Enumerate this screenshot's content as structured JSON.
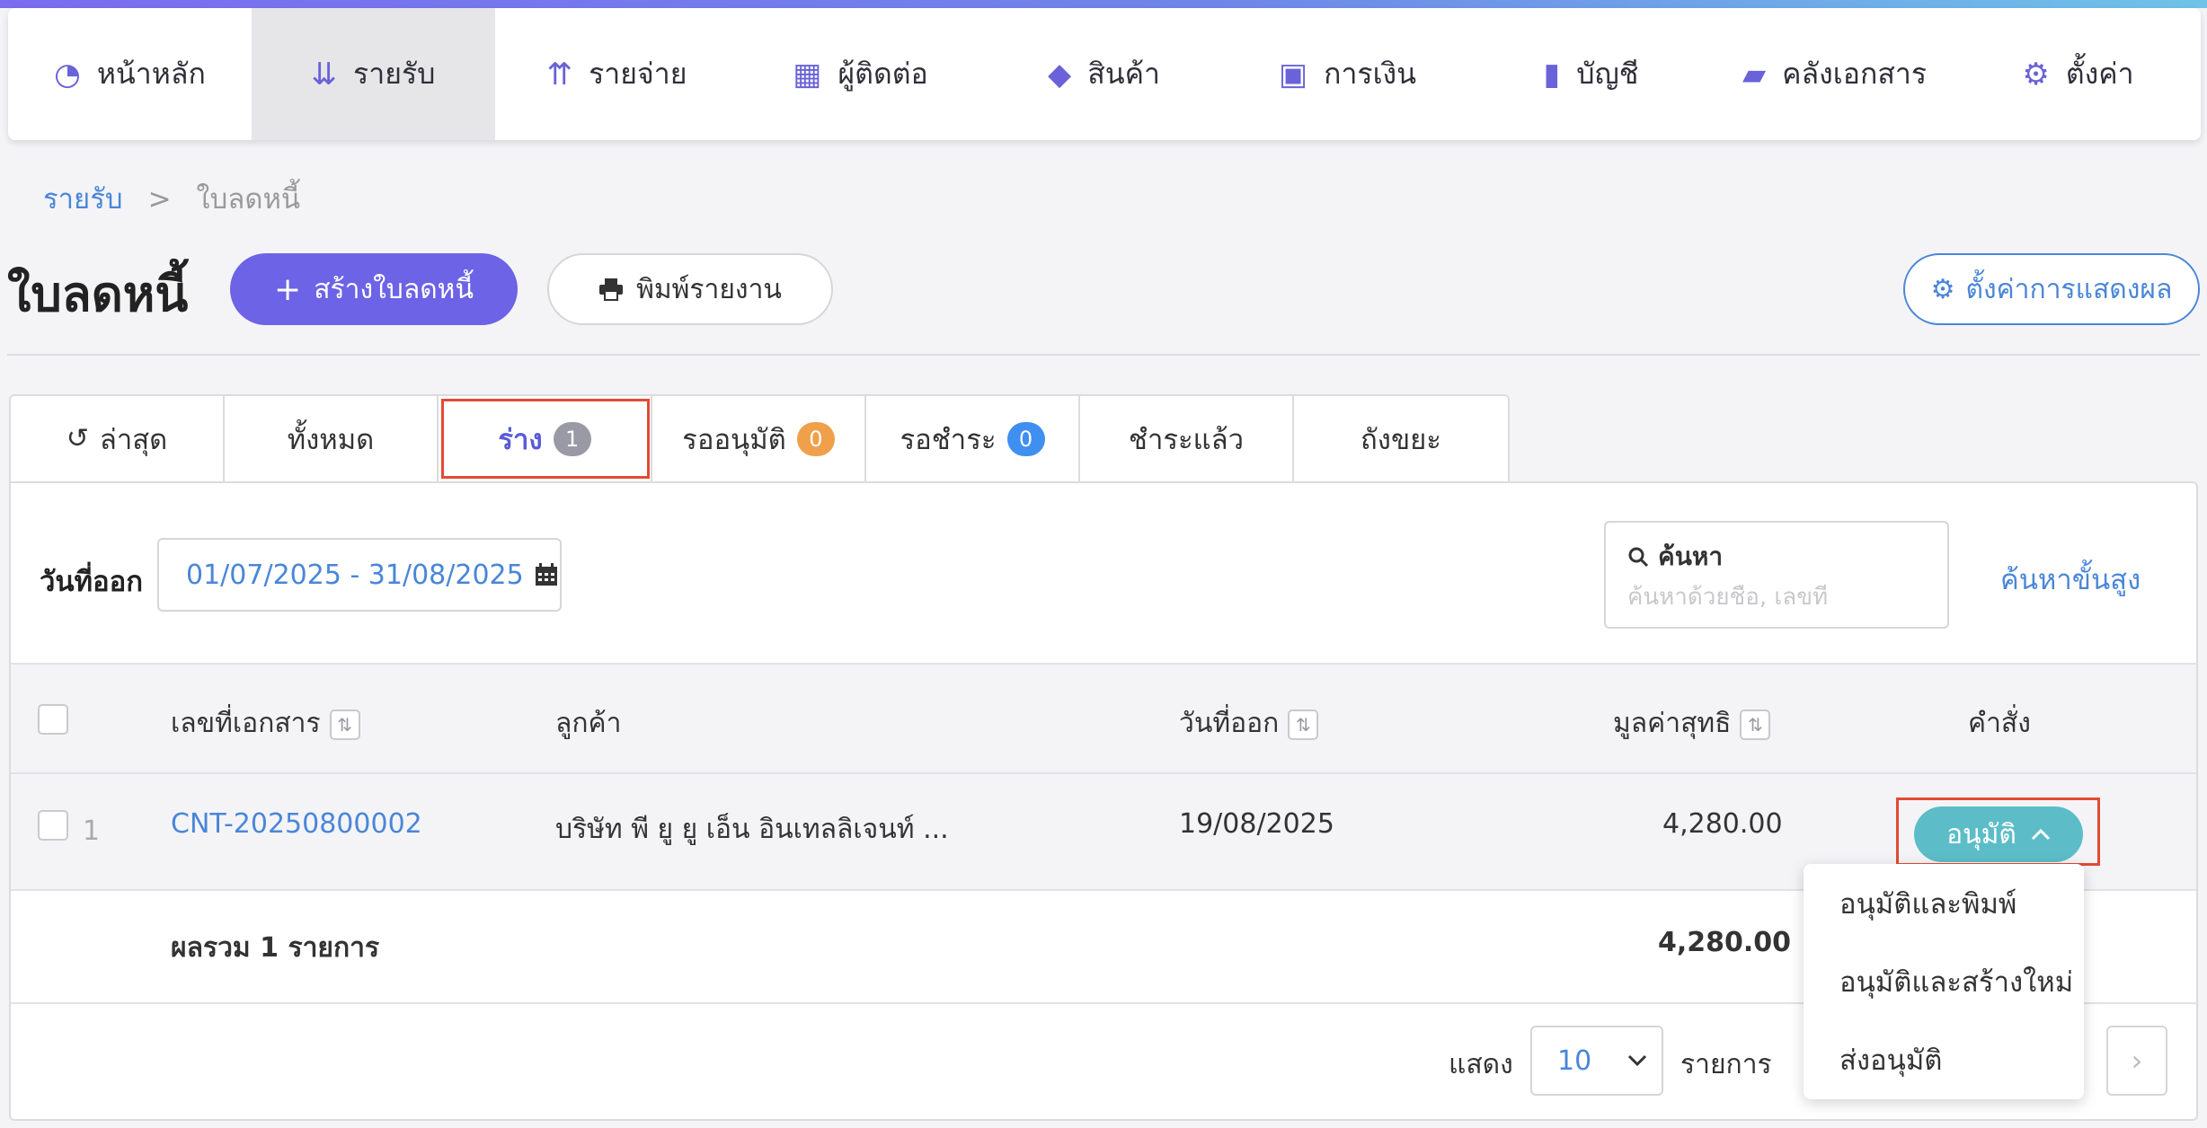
{
  "nav": [
    {
      "label": "หน้าหลัก",
      "icon": "dashboard-icon",
      "glyph": "◔"
    },
    {
      "label": "รายรับ",
      "icon": "income-icon",
      "glyph": "⇊",
      "active": true
    },
    {
      "label": "รายจ่าย",
      "icon": "expense-icon",
      "glyph": "⇈"
    },
    {
      "label": "ผู้ติดต่อ",
      "icon": "contacts-icon",
      "glyph": "▦"
    },
    {
      "label": "สินค้า",
      "icon": "box-icon",
      "glyph": "◆"
    },
    {
      "label": "การเงิน",
      "icon": "money-icon",
      "glyph": "▣"
    },
    {
      "label": "บัญชี",
      "icon": "ledger-icon",
      "glyph": "▮"
    },
    {
      "label": "คลังเอกสาร",
      "icon": "folder-icon",
      "glyph": "▰"
    },
    {
      "label": "ตั้งค่า",
      "icon": "gear-icon",
      "glyph": "⚙"
    }
  ],
  "breadcrumb": {
    "parent": "รายรับ",
    "separator": ">",
    "current": "ใบลดหนี้"
  },
  "header": {
    "title": "ใบลดหนี้",
    "create_label": "สร้างใบลดหนี้",
    "print_label": "พิมพ์รายงาน",
    "display_settings_label": "ตั้งค่าการแสดงผล"
  },
  "tabs": [
    {
      "label": "ล่าสุด",
      "icon": "history-icon"
    },
    {
      "label": "ทั้งหมด"
    },
    {
      "label": "ร่าง",
      "count": "1",
      "active": true
    },
    {
      "label": "รออนุมัติ",
      "count": "0"
    },
    {
      "label": "รอชำระ",
      "count": "0"
    },
    {
      "label": "ชำระแล้ว"
    },
    {
      "label": "ถังขยะ"
    }
  ],
  "filter": {
    "date_label": "วันที่ออก",
    "date_range": "01/07/2025 - 31/08/2025"
  },
  "search": {
    "label": "ค้นหา",
    "placeholder": "ค้นหาด้วยชื่อ, เลขที่",
    "advanced_label": "ค้นหาขั้นสูง"
  },
  "table": {
    "columns": {
      "doc_no": "เลขที่เอกสาร",
      "customer": "ลูกค้า",
      "issue_date": "วันที่ออก",
      "net_value": "มูลค่าสุทธิ",
      "action": "คำสั่ง"
    },
    "rows": [
      {
        "index": "1",
        "doc_no": "CNT-20250800002",
        "customer": "บริษัท พี ยู ยู เอ็น อินเทลลิเจนท์ ...",
        "issue_date": "19/08/2025",
        "net_value": "4,280.00",
        "action": "อนุมัติ"
      }
    ],
    "summary": {
      "label": "ผลรวม 1 รายการ",
      "total": "4,280.00"
    }
  },
  "action_menu": [
    "อนุมัติและพิมพ์",
    "อนุมัติและสร้างใหม่",
    "ส่งอนุมัติ"
  ],
  "pagination": {
    "show_label": "แสดง",
    "page_size": "10",
    "items_label": "รายการ"
  },
  "colors": {
    "primary": "#6c63e6",
    "link": "#4a86d8",
    "approve": "#5cbdc8",
    "highlight": "#e34a33"
  }
}
